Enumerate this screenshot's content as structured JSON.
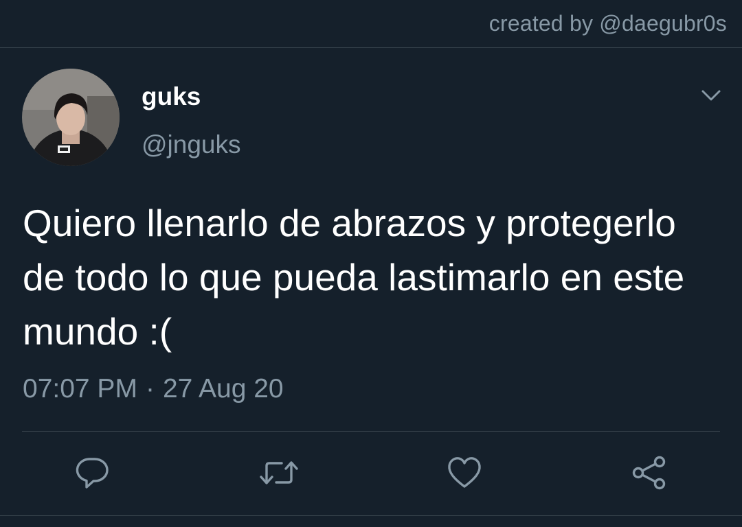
{
  "credit": "created by @daegubr0s",
  "tweet": {
    "author": {
      "display_name": "guks",
      "handle": "@jnguks",
      "avatar_icon": "profile-photo"
    },
    "text": "Quiero llenarlo de abrazos y protegerlo de todo lo que pueda lastimarlo en este mundo :(",
    "time": "07:07 PM",
    "date": "27 Aug 20",
    "separator": "·"
  },
  "actions": [
    {
      "icon": "reply-icon"
    },
    {
      "icon": "retweet-icon"
    },
    {
      "icon": "like-icon"
    },
    {
      "icon": "share-icon"
    }
  ],
  "colors": {
    "background": "#15202b",
    "text_primary": "#ffffff",
    "text_secondary": "#8899a6",
    "divider": "#38444d"
  }
}
